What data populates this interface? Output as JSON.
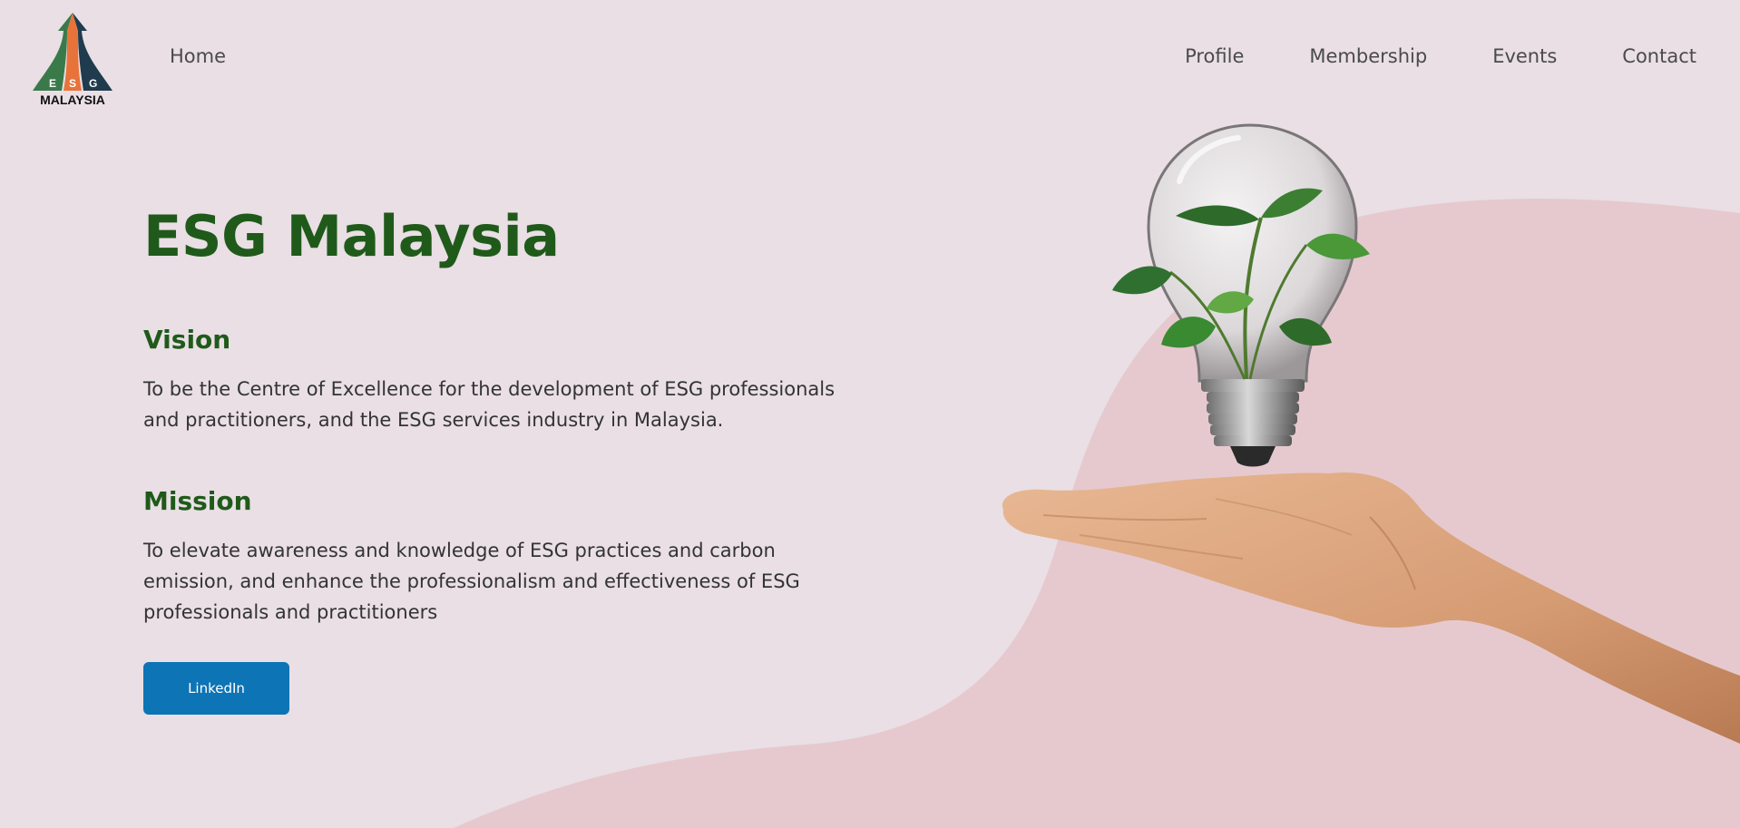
{
  "header": {
    "logo": {
      "letters": [
        "E",
        "S",
        "G"
      ],
      "wordmark": "MALAYSIA"
    },
    "home_label": "Home",
    "nav": [
      {
        "label": "Profile"
      },
      {
        "label": "Membership"
      },
      {
        "label": "Events"
      },
      {
        "label": "Contact"
      }
    ]
  },
  "hero": {
    "title": "ESG Malaysia",
    "vision_heading": "Vision",
    "vision_text": "To be the Centre of Excellence for the development of ESG professionals and practitioners, and the ESG services industry in Malaysia.",
    "mission_heading": "Mission",
    "mission_text": "To elevate awareness and knowledge of ESG practices and carbon emission, and enhance the professionalism and effectiveness of ESG professionals and practitioners",
    "button_label": "LinkedIn"
  },
  "colors": {
    "background": "#e9dfe4",
    "blob": "#e6c9ce",
    "heading": "#1f5a1a",
    "button": "#0d74b5",
    "logo_green": "#3a7a4a",
    "logo_orange": "#e8733a",
    "logo_navy": "#1f3b4d"
  },
  "illustration": {
    "icons": [
      "lightbulb-icon",
      "plant-icon",
      "hand-icon"
    ]
  }
}
